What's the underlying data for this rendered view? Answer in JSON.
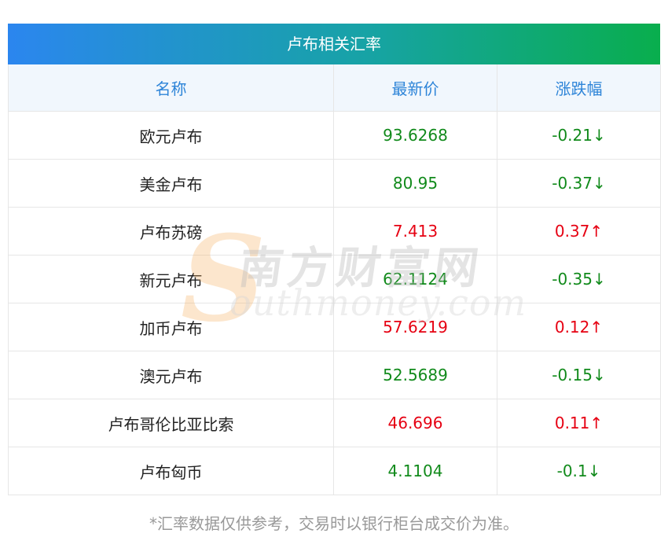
{
  "table": {
    "title": "卢布相关汇率",
    "headers": [
      "名称",
      "最新价",
      "涨跌幅"
    ],
    "rows": [
      {
        "name": "欧元卢布",
        "price": "93.6268",
        "change": "-0.21↓",
        "direction": "down"
      },
      {
        "name": "美金卢布",
        "price": "80.95",
        "change": "-0.37↓",
        "direction": "down"
      },
      {
        "name": "卢布苏磅",
        "price": "7.413",
        "change": "0.37↑",
        "direction": "up"
      },
      {
        "name": "新元卢布",
        "price": "62.1124",
        "change": "-0.35↓",
        "direction": "down"
      },
      {
        "name": "加币卢布",
        "price": "57.6219",
        "change": "0.12↑",
        "direction": "up"
      },
      {
        "name": "澳元卢布",
        "price": "52.5689",
        "change": "-0.15↓",
        "direction": "down"
      },
      {
        "name": "卢布哥伦比亚比索",
        "price": "46.696",
        "change": "0.11↑",
        "direction": "up"
      },
      {
        "name": "卢布匈币",
        "price": "4.1104",
        "change": "-0.1↓",
        "direction": "down"
      }
    ]
  },
  "footnote": "*汇率数据仅供参考，交易时以银行柜台成交价为准。",
  "watermark": {
    "cn": "南方财富网",
    "en": "outhmoney.com",
    "s_glyph": "S"
  },
  "colors": {
    "up": "#e60012",
    "down": "#118a1b",
    "header_text": "#2d84d8",
    "title_gradient_start": "#2b86ef",
    "title_gradient_end": "#09ae4d"
  }
}
